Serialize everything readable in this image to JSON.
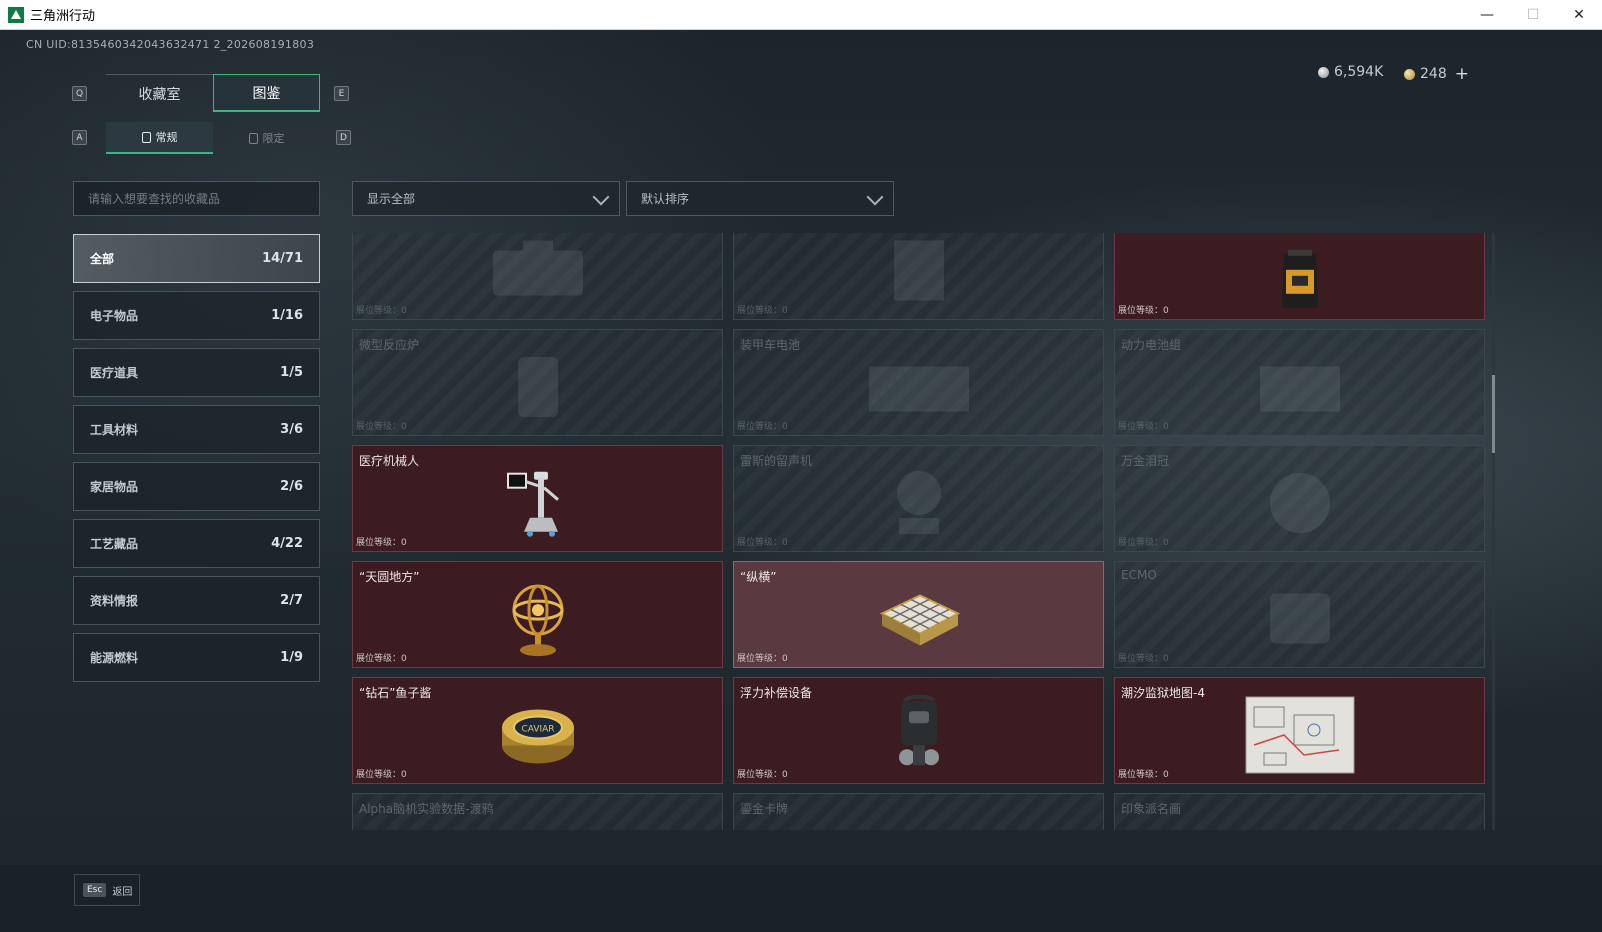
{
  "window": {
    "title": "三角洲行动",
    "minimize": "—",
    "maximize": "☐",
    "close": "✕"
  },
  "uid": "CN UID:8135460342043632471 2_202608191803",
  "currency": {
    "silver": "6,594K",
    "gold": "248",
    "add": "+"
  },
  "hints": {
    "q": "Q",
    "e": "E",
    "a": "A",
    "d": "D"
  },
  "tabs": [
    {
      "label": "收藏室"
    },
    {
      "label": "图鉴"
    }
  ],
  "subtabs": [
    {
      "label": "常规"
    },
    {
      "label": "限定"
    }
  ],
  "search": {
    "placeholder": "请输入想要查找的收藏品"
  },
  "filters": {
    "show": "显示全部",
    "sort": "默认排序"
  },
  "categories": [
    {
      "label": "全部",
      "count": "14/71"
    },
    {
      "label": "电子物品",
      "count": "1/16"
    },
    {
      "label": "医疗道具",
      "count": "1/5"
    },
    {
      "label": "工具材料",
      "count": "3/6"
    },
    {
      "label": "家居物品",
      "count": "2/6"
    },
    {
      "label": "工艺藏品",
      "count": "4/22"
    },
    {
      "label": "资料情报",
      "count": "2/7"
    },
    {
      "label": "能源燃料",
      "count": "1/9"
    }
  ],
  "level_label": "展位等级：",
  "items": [
    {
      "name": "",
      "level": "0",
      "owned": false,
      "icon": "case-icon"
    },
    {
      "name": "",
      "level": "0",
      "owned": false,
      "icon": "machine-icon"
    },
    {
      "name": "",
      "level": "0",
      "owned": true,
      "icon": "coffee-bag-icon"
    },
    {
      "name": "微型反应炉",
      "level": "0",
      "owned": false,
      "icon": "reactor-icon"
    },
    {
      "name": "装甲车电池",
      "level": "0",
      "owned": false,
      "icon": "battery-icon"
    },
    {
      "name": "动力电池组",
      "level": "0",
      "owned": false,
      "icon": "power-pack-icon"
    },
    {
      "name": "医疗机械人",
      "level": "0",
      "owned": true,
      "icon": "medical-robot-icon"
    },
    {
      "name": "雷斯的留声机",
      "level": "0",
      "owned": false,
      "icon": "phonograph-icon"
    },
    {
      "name": "万金泪冠",
      "level": "0",
      "owned": false,
      "icon": "crown-icon"
    },
    {
      "name": "“天圆地方”",
      "level": "0",
      "owned": true,
      "icon": "armillary-sphere-icon"
    },
    {
      "name": "“纵横”",
      "level": "0",
      "owned": true,
      "icon": "chess-board-icon"
    },
    {
      "name": "ECMO",
      "level": "0",
      "owned": false,
      "icon": "ecmo-machine-icon"
    },
    {
      "name": "“钻石”鱼子酱",
      "level": "0",
      "owned": true,
      "icon": "caviar-tin-icon"
    },
    {
      "name": "浮力补偿设备",
      "level": "0",
      "owned": true,
      "icon": "buoyancy-device-icon"
    },
    {
      "name": "潮汐监狱地图-4",
      "level": "0",
      "owned": true,
      "icon": "map-icon"
    },
    {
      "name": "Alpha脑机实验数据-渡鸦",
      "level": "",
      "owned": false,
      "icon": "data-icon"
    },
    {
      "name": "鎏金卡牌",
      "level": "",
      "owned": false,
      "icon": "card-icon"
    },
    {
      "name": "印象派名画",
      "level": "",
      "owned": false,
      "icon": "painting-icon"
    }
  ],
  "caviar_label": "CAVIAR",
  "footer": {
    "esc_key": "Esc",
    "back": "返回"
  }
}
